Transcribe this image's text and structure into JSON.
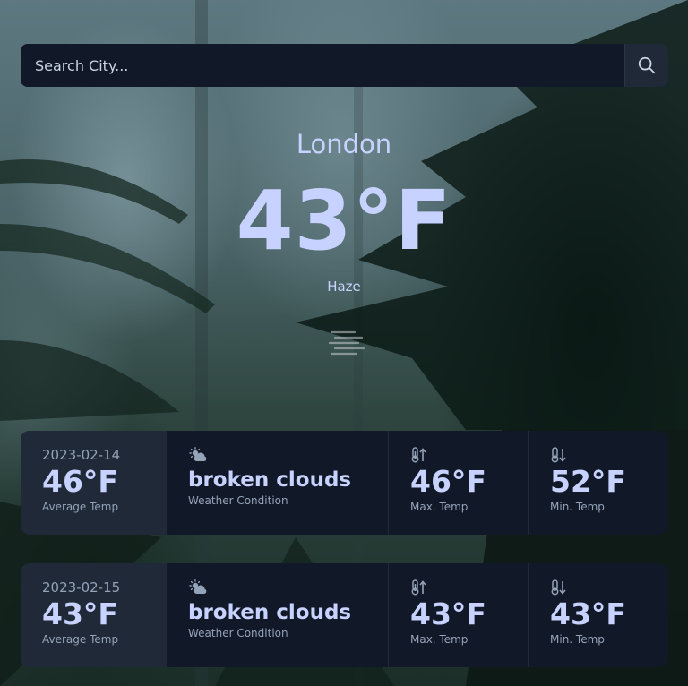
{
  "search": {
    "placeholder": "Search City..."
  },
  "current": {
    "city": "London",
    "temperature": "43°F",
    "condition": "Haze"
  },
  "forecast": [
    {
      "date": "2023-02-14",
      "avg_temp": "46°F",
      "avg_label": "Average Temp",
      "condition": "broken clouds",
      "condition_label": "Weather Condition",
      "max_temp": "46°F",
      "max_label": "Max. Temp",
      "min_temp": "52°F",
      "min_label": "Min. Temp"
    },
    {
      "date": "2023-02-15",
      "avg_temp": "43°F",
      "avg_label": "Average Temp",
      "condition": "broken clouds",
      "condition_label": "Weather Condition",
      "max_temp": "43°F",
      "max_label": "Max. Temp",
      "min_temp": "43°F",
      "min_label": "Min. Temp"
    }
  ],
  "icons": {
    "search": "search-icon",
    "haze": "haze-icon",
    "condition": "cloud-sun-icon",
    "max": "thermometer-up-icon",
    "min": "thermometer-down-icon"
  },
  "colors": {
    "panel": "#111827",
    "panel_alt": "#1f2937",
    "text": "#c7d2fe",
    "muted": "#94a3b8"
  }
}
